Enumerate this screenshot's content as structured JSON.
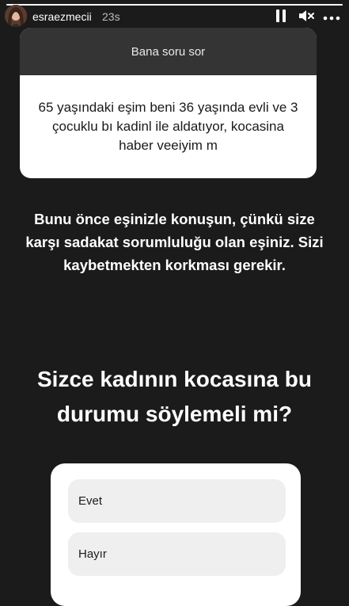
{
  "story": {
    "progress": 1.0,
    "username": "esraezmecii",
    "timestamp": "23s"
  },
  "controls": {
    "pause_icon": "pause-icon",
    "mute_icon": "speaker-muted-icon",
    "more_icon": "more-horizontal-icon"
  },
  "question_card": {
    "header": "Bana soru sor",
    "text": "65 yaşındaki eşim beni 36 yaşında evli ve 3 çocuklu bı kadinl ile aldatıyor, kocasina haber veeiyim m"
  },
  "answer": {
    "text": "Bunu önce eşinizle konuşun, çünkü size karşı sadakat sorumluluğu olan eşiniz. Sizi kaybetmekten korkması gerekir."
  },
  "poll": {
    "question": "Sizce kadının kocasına bu durumu söylemeli mi?",
    "options": [
      {
        "label": "Evet"
      },
      {
        "label": "Hayır"
      }
    ]
  }
}
